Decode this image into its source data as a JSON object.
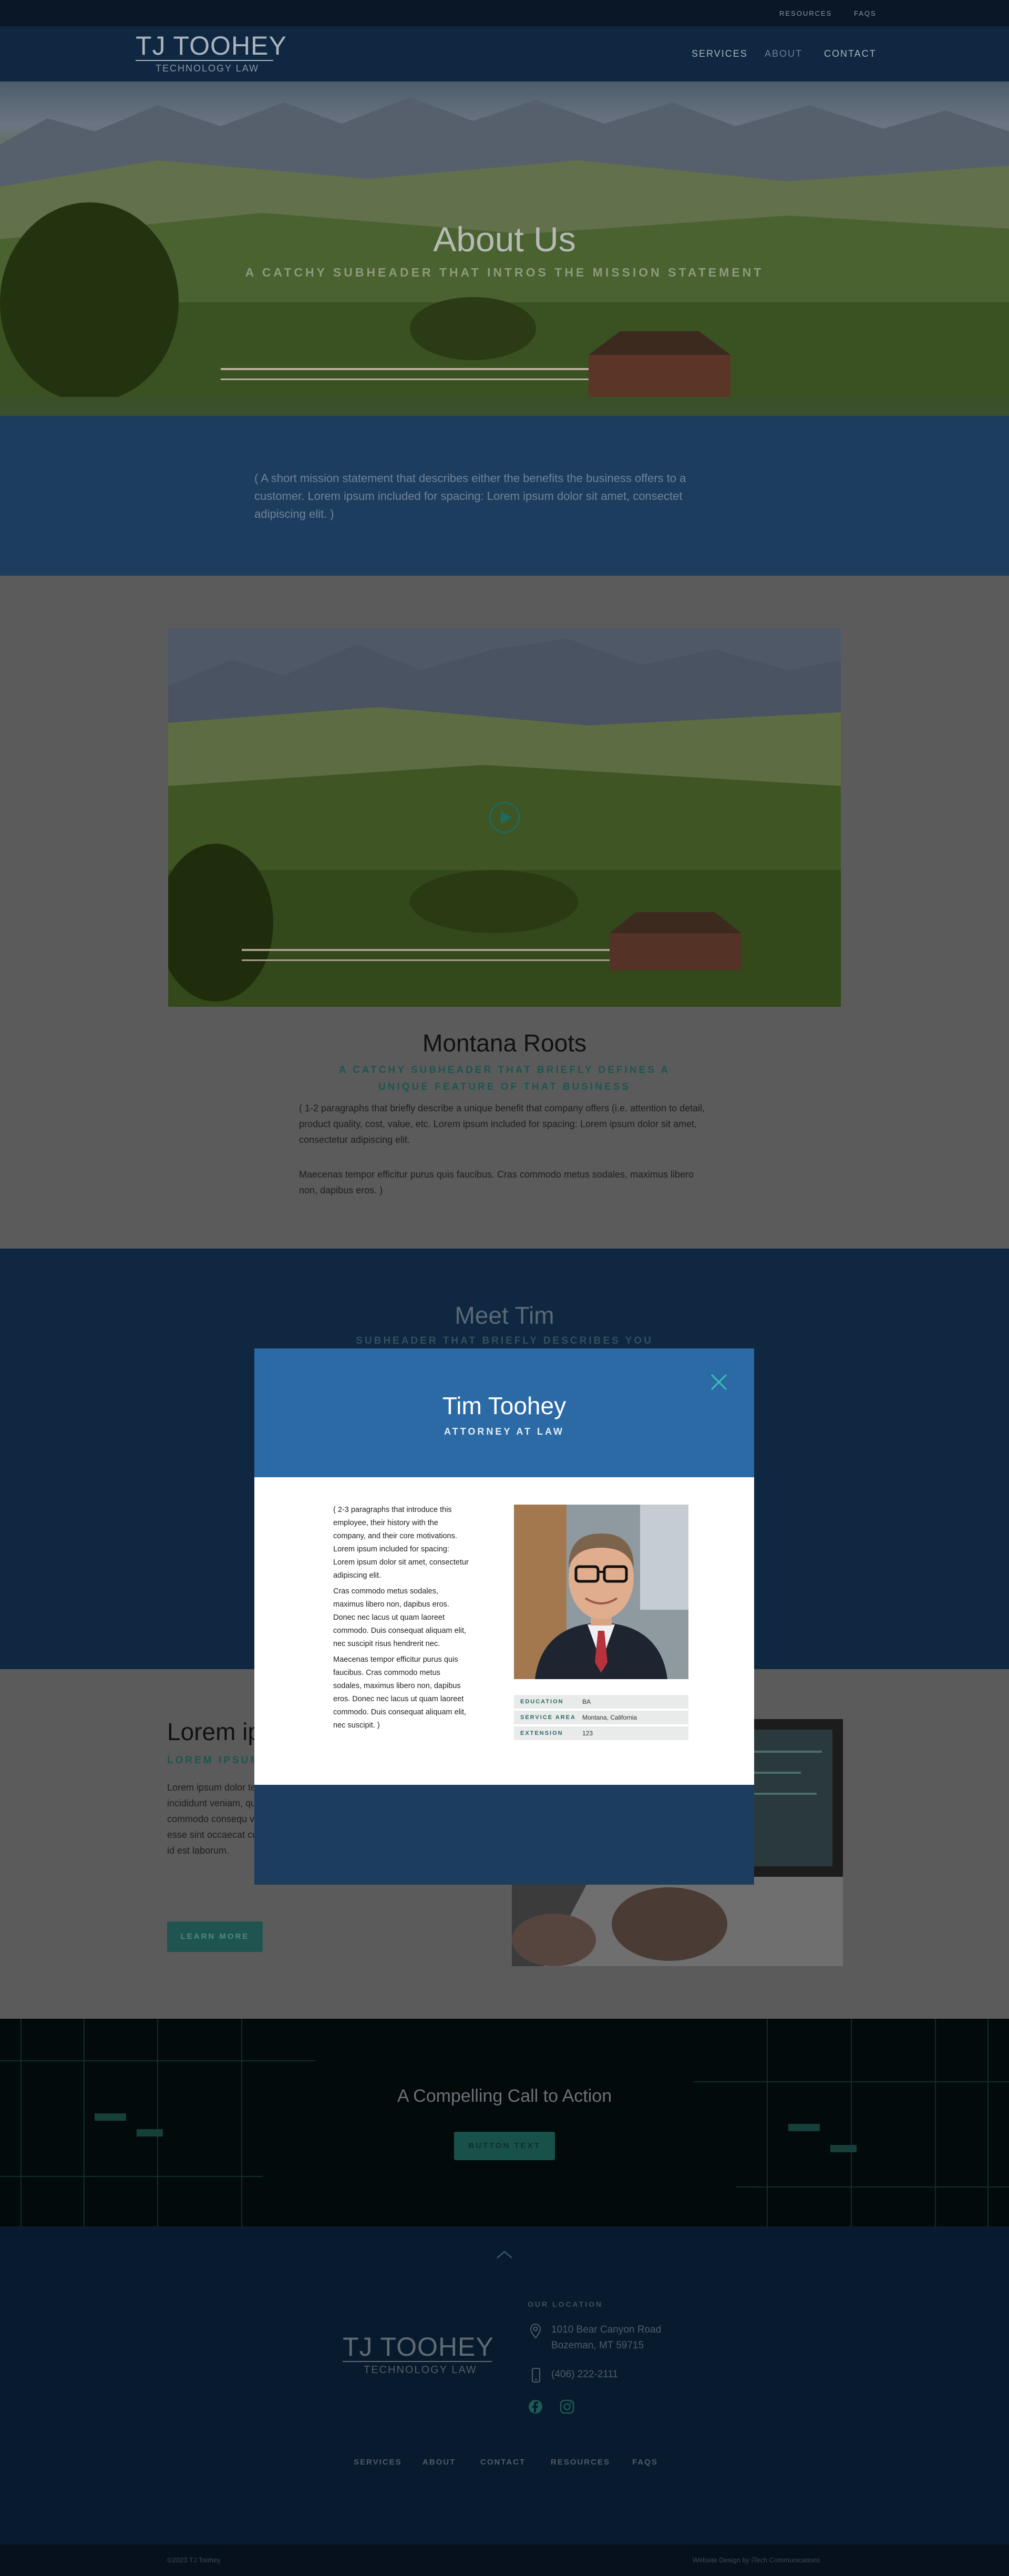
{
  "topbar": {
    "resources": "RESOURCES",
    "faqs": "FAQS"
  },
  "header": {
    "logo_title": "TJ TOOHEY",
    "logo_subtitle": "TECHNOLOGY LAW",
    "nav": {
      "services": "SERVICES",
      "about": "ABOUT",
      "contact": "CONTACT"
    }
  },
  "hero": {
    "title": "About Us",
    "subtitle": "A CATCHY SUBHEADER THAT INTROS THE MISSION STATEMENT"
  },
  "mission": {
    "text": "( A short mission statement that describes either the benefits the business offers to a customer. Lorem ipsum included for spacing: Lorem ipsum dolor sit amet, consectet adipiscing elit. )"
  },
  "roots": {
    "title": "Montana Roots",
    "subtitle": "A CATCHY SUBHEADER THAT BRIEFLY DEFINES A UNIQUE FEATURE OF THAT BUSINESS",
    "paragraph_1": "( 1-2 paragraphs that briefly describe a unique benefit that company offers (i.e. attention to detail, product quality, cost, value, etc. Lorem ipsum included for spacing: Lorem ipsum dolor sit amet, consectetur adipiscing elit.",
    "paragraph_2": "Maecenas tempor efficitur purus quis faucibus. Cras commodo metus sodales, maximus libero non, dapibus eros. )"
  },
  "meet": {
    "title": "Meet Tim",
    "subtitle": "SUBHEADER THAT BRIEFLY DESCRIBES YOU"
  },
  "modal": {
    "name": "Tim Toohey",
    "role": "ATTORNEY AT LAW",
    "paragraph_1": "( 2-3 paragraphs that introduce this employee, their history with the company, and their core motivations. Lorem ipsum included for spacing: Lorem ipsum dolor sit amet, consectetur adipiscing elit.",
    "paragraph_2": "Cras commodo metus sodales, maximus libero non, dapibus eros. Donec nec lacus ut quam laoreet commodo. Duis consequat aliquam elit, nec suscipit risus hendrerit nec.",
    "paragraph_3": "Maecenas tempor efficitur purus quis faucibus. Cras commodo metus sodales, maximus libero non, dapibus eros. Donec nec lacus ut quam laoreet commodo. Duis consequat aliquam elit, nec suscipit. )",
    "info": [
      {
        "label": "EDUCATION",
        "value": "BA"
      },
      {
        "label": "SERVICE AREA",
        "value": "Montana, California"
      },
      {
        "label": "EXTENSION",
        "value": "123"
      }
    ]
  },
  "lorem": {
    "title": "Lorem ip",
    "subtitle": "LOREM IPSUM",
    "text": "Lorem ipsum dolor tempor incididunt veniam, quis nostru commodo consequ voluptate velit esse sint occaecat cupid mollit anim id est laborum.",
    "button": "LEARN MORE"
  },
  "cta": {
    "title": "A Compelling Call to Action",
    "button": "BUTTON TEXT"
  },
  "footer": {
    "logo_title": "TJ TOOHEY",
    "logo_subtitle": "TECHNOLOGY LAW",
    "location_label": "OUR LOCATION",
    "address_line1": "1010 Bear Canyon Road",
    "address_line2": "Bozeman, MT 59715",
    "phone": "(406) 222-2111",
    "nav": {
      "services": "SERVICES",
      "about": "ABOUT",
      "contact": "CONTACT",
      "resources": "RESOURCES",
      "faqs": "FAQS"
    },
    "copyright": "©2023 TJ Toohey",
    "credit": "Website Design by iTech Communications"
  },
  "colors": {
    "brand_navy": "#0f2740",
    "modal_blue": "#2c6aa6",
    "accent_teal": "#1f5450"
  }
}
